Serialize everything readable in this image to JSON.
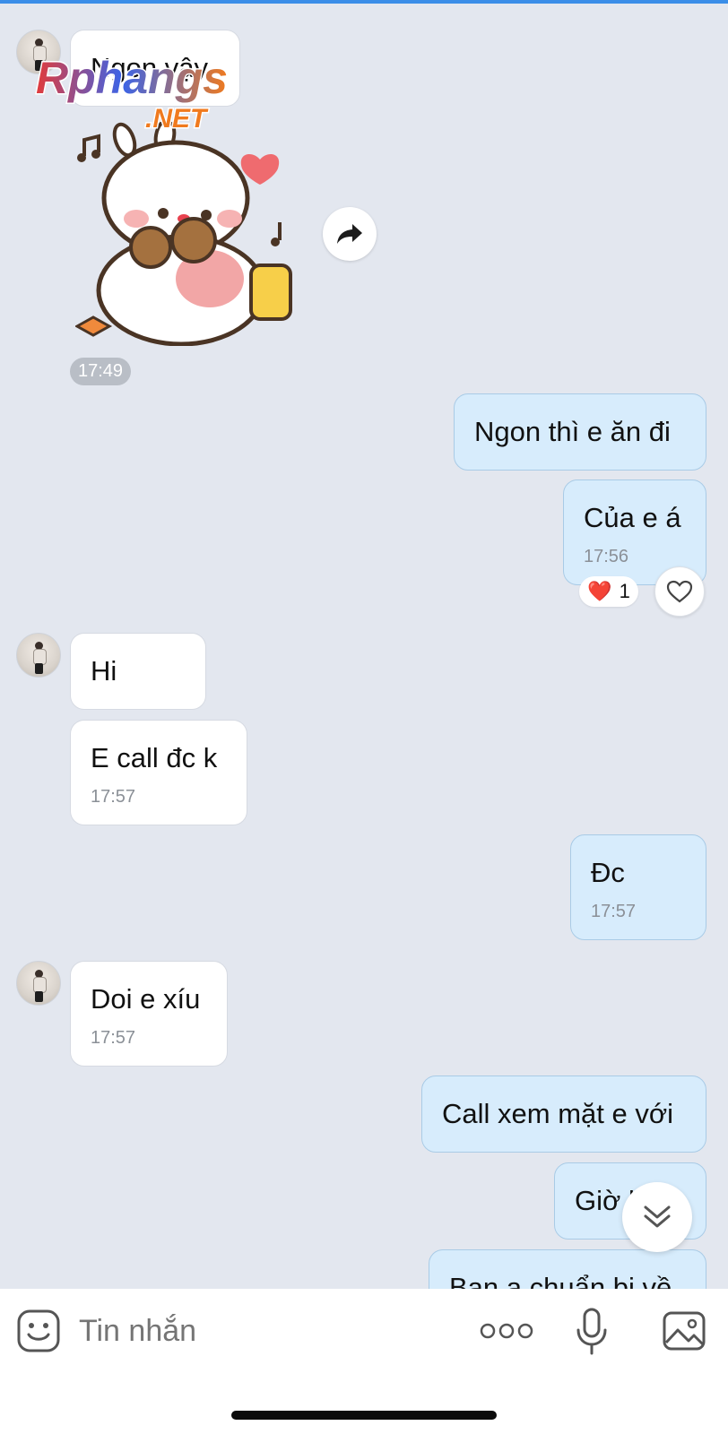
{
  "watermark": {
    "brand": "Rphangs",
    "suffix": ".NET"
  },
  "messages": [
    {
      "side": "in",
      "text": "Ngon vậy"
    },
    {
      "side": "in",
      "type": "sticker",
      "time": "17:49",
      "icon": "bunny-eating-cookie-sticker"
    },
    {
      "side": "out",
      "text": "Ngon thì e ăn đi"
    },
    {
      "side": "out",
      "text": "Của e á",
      "time": "17:56",
      "reaction": {
        "emoji": "❤️",
        "count": "1"
      }
    },
    {
      "side": "in",
      "text": "Hi"
    },
    {
      "side": "in",
      "text": "E call đc k",
      "time": "17:57"
    },
    {
      "side": "out",
      "text": "Đc",
      "time": "17:57"
    },
    {
      "side": "in",
      "text": "Doi e xíu",
      "time": "17:57"
    },
    {
      "side": "out",
      "text": "Call xem mặt e với"
    },
    {
      "side": "out",
      "text": "Giờ l"
    },
    {
      "side": "out",
      "text": "Ban a chuẩn bị về"
    }
  ],
  "composer": {
    "placeholder": "Tin nhắn",
    "icons": [
      "emoji-icon",
      "more-icon",
      "mic-icon",
      "gallery-icon"
    ]
  },
  "colors": {
    "background": "#e3e7ef",
    "incoming_bubble": "#ffffff",
    "outgoing_bubble": "#d7ecfc",
    "accent": "#3b8ee8",
    "heart": "#e8424f"
  }
}
